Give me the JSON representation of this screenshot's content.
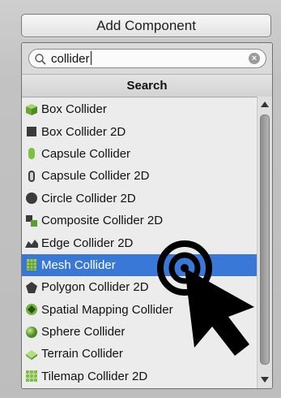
{
  "add_component": {
    "label": "Add Component"
  },
  "search": {
    "value": "collider"
  },
  "list_header": "Search",
  "items": [
    {
      "label": "Box Collider",
      "icon": "box-collider-icon",
      "selected": false
    },
    {
      "label": "Box Collider 2D",
      "icon": "box-collider-2d-icon",
      "selected": false
    },
    {
      "label": "Capsule Collider",
      "icon": "capsule-collider-icon",
      "selected": false
    },
    {
      "label": "Capsule Collider 2D",
      "icon": "capsule-collider-2d-icon",
      "selected": false
    },
    {
      "label": "Circle Collider 2D",
      "icon": "circle-collider-2d-icon",
      "selected": false
    },
    {
      "label": "Composite Collider 2D",
      "icon": "composite-collider-2d-icon",
      "selected": false
    },
    {
      "label": "Edge Collider 2D",
      "icon": "edge-collider-2d-icon",
      "selected": false
    },
    {
      "label": "Mesh Collider",
      "icon": "mesh-collider-icon",
      "selected": true
    },
    {
      "label": "Polygon Collider 2D",
      "icon": "polygon-collider-2d-icon",
      "selected": false
    },
    {
      "label": "Spatial Mapping Collider",
      "icon": "spatial-mapping-collider-icon",
      "selected": false
    },
    {
      "label": "Sphere Collider",
      "icon": "sphere-collider-icon",
      "selected": false
    },
    {
      "label": "Terrain Collider",
      "icon": "terrain-collider-icon",
      "selected": false
    },
    {
      "label": "Tilemap Collider 2D",
      "icon": "tilemap-collider-2d-icon",
      "selected": false
    }
  ],
  "colors": {
    "selection": "#3a78d8",
    "icon_green": "#72b83a"
  }
}
